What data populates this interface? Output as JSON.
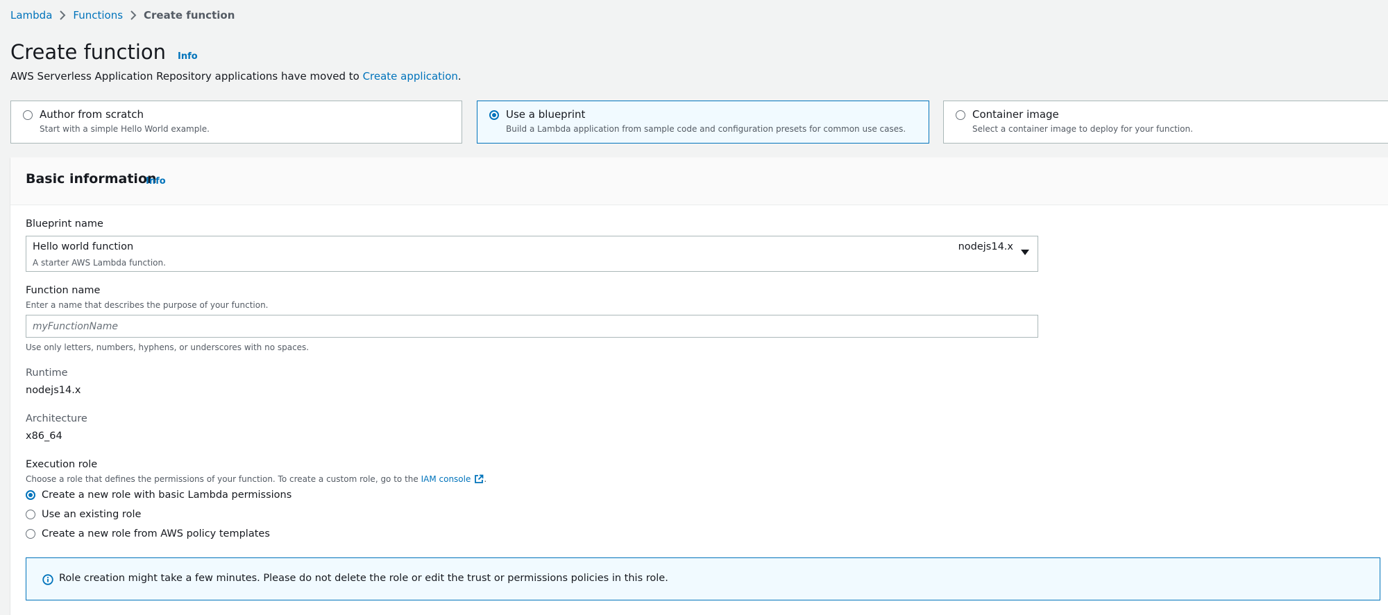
{
  "breadcrumb": {
    "items": [
      "Lambda",
      "Functions"
    ],
    "current": "Create function"
  },
  "page": {
    "title": "Create function",
    "info": "Info",
    "subtitle_prefix": "AWS Serverless Application Repository applications have moved to ",
    "subtitle_link": "Create application",
    "subtitle_suffix": "."
  },
  "options": [
    {
      "title": "Author from scratch",
      "desc": "Start with a simple Hello World example.",
      "selected": false
    },
    {
      "title": "Use a blueprint",
      "desc": "Build a Lambda application from sample code and configuration presets for common use cases.",
      "selected": true
    },
    {
      "title": "Container image",
      "desc": "Select a container image to deploy for your function.",
      "selected": false
    }
  ],
  "basic_info": {
    "title": "Basic information",
    "info": "Info",
    "blueprint": {
      "label": "Blueprint name",
      "value": "Hello world function",
      "desc": "A starter AWS Lambda function.",
      "runtime": "nodejs14.x"
    },
    "function_name": {
      "label": "Function name",
      "desc": "Enter a name that describes the purpose of your function.",
      "placeholder": "myFunctionName",
      "value": "",
      "hint": "Use only letters, numbers, hyphens, or underscores with no spaces."
    },
    "runtime": {
      "label": "Runtime",
      "value": "nodejs14.x"
    },
    "architecture": {
      "label": "Architecture",
      "value": "x86_64"
    },
    "execution_role": {
      "label": "Execution role",
      "desc_prefix": "Choose a role that defines the permissions of your function. To create a custom role, go to the ",
      "desc_link": "IAM console",
      "desc_suffix": ".",
      "options": [
        {
          "label": "Create a new role with basic Lambda permissions",
          "selected": true
        },
        {
          "label": "Use an existing role",
          "selected": false
        },
        {
          "label": "Create a new role from AWS policy templates",
          "selected": false
        }
      ]
    },
    "alert": "Role creation might take a few minutes. Please do not delete the role or edit the trust or permissions policies in this role."
  },
  "colors": {
    "link": "#0073bb",
    "background": "#f2f3f3",
    "selected_bg": "#f1faff"
  }
}
